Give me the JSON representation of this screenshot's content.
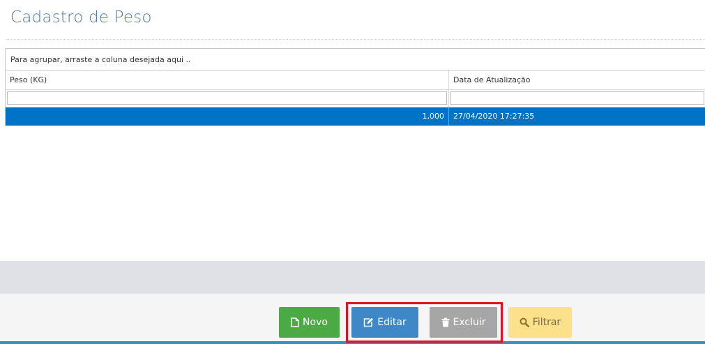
{
  "page": {
    "title": "Cadastro de Peso"
  },
  "grid": {
    "group_panel_text": "Para agrupar, arraste a coluna desejada aqui ..",
    "columns": [
      "Peso (KG)",
      "Data de Atualização"
    ],
    "rows": [
      {
        "peso": "1,000",
        "data": "27/04/2020 17:27:35",
        "selected": true
      }
    ]
  },
  "toolbar": {
    "novo_label": "Novo",
    "editar_label": "Editar",
    "excluir_label": "Excluir",
    "filtrar_label": "Filtrar"
  },
  "colors": {
    "title": "#4a7ab0",
    "selected_row": "#0073c6",
    "novo": "#4caa44",
    "editar": "#3f88c8",
    "excluir": "#a6a6a6",
    "filtrar": "#fde08a",
    "highlight": "#e0141e"
  }
}
